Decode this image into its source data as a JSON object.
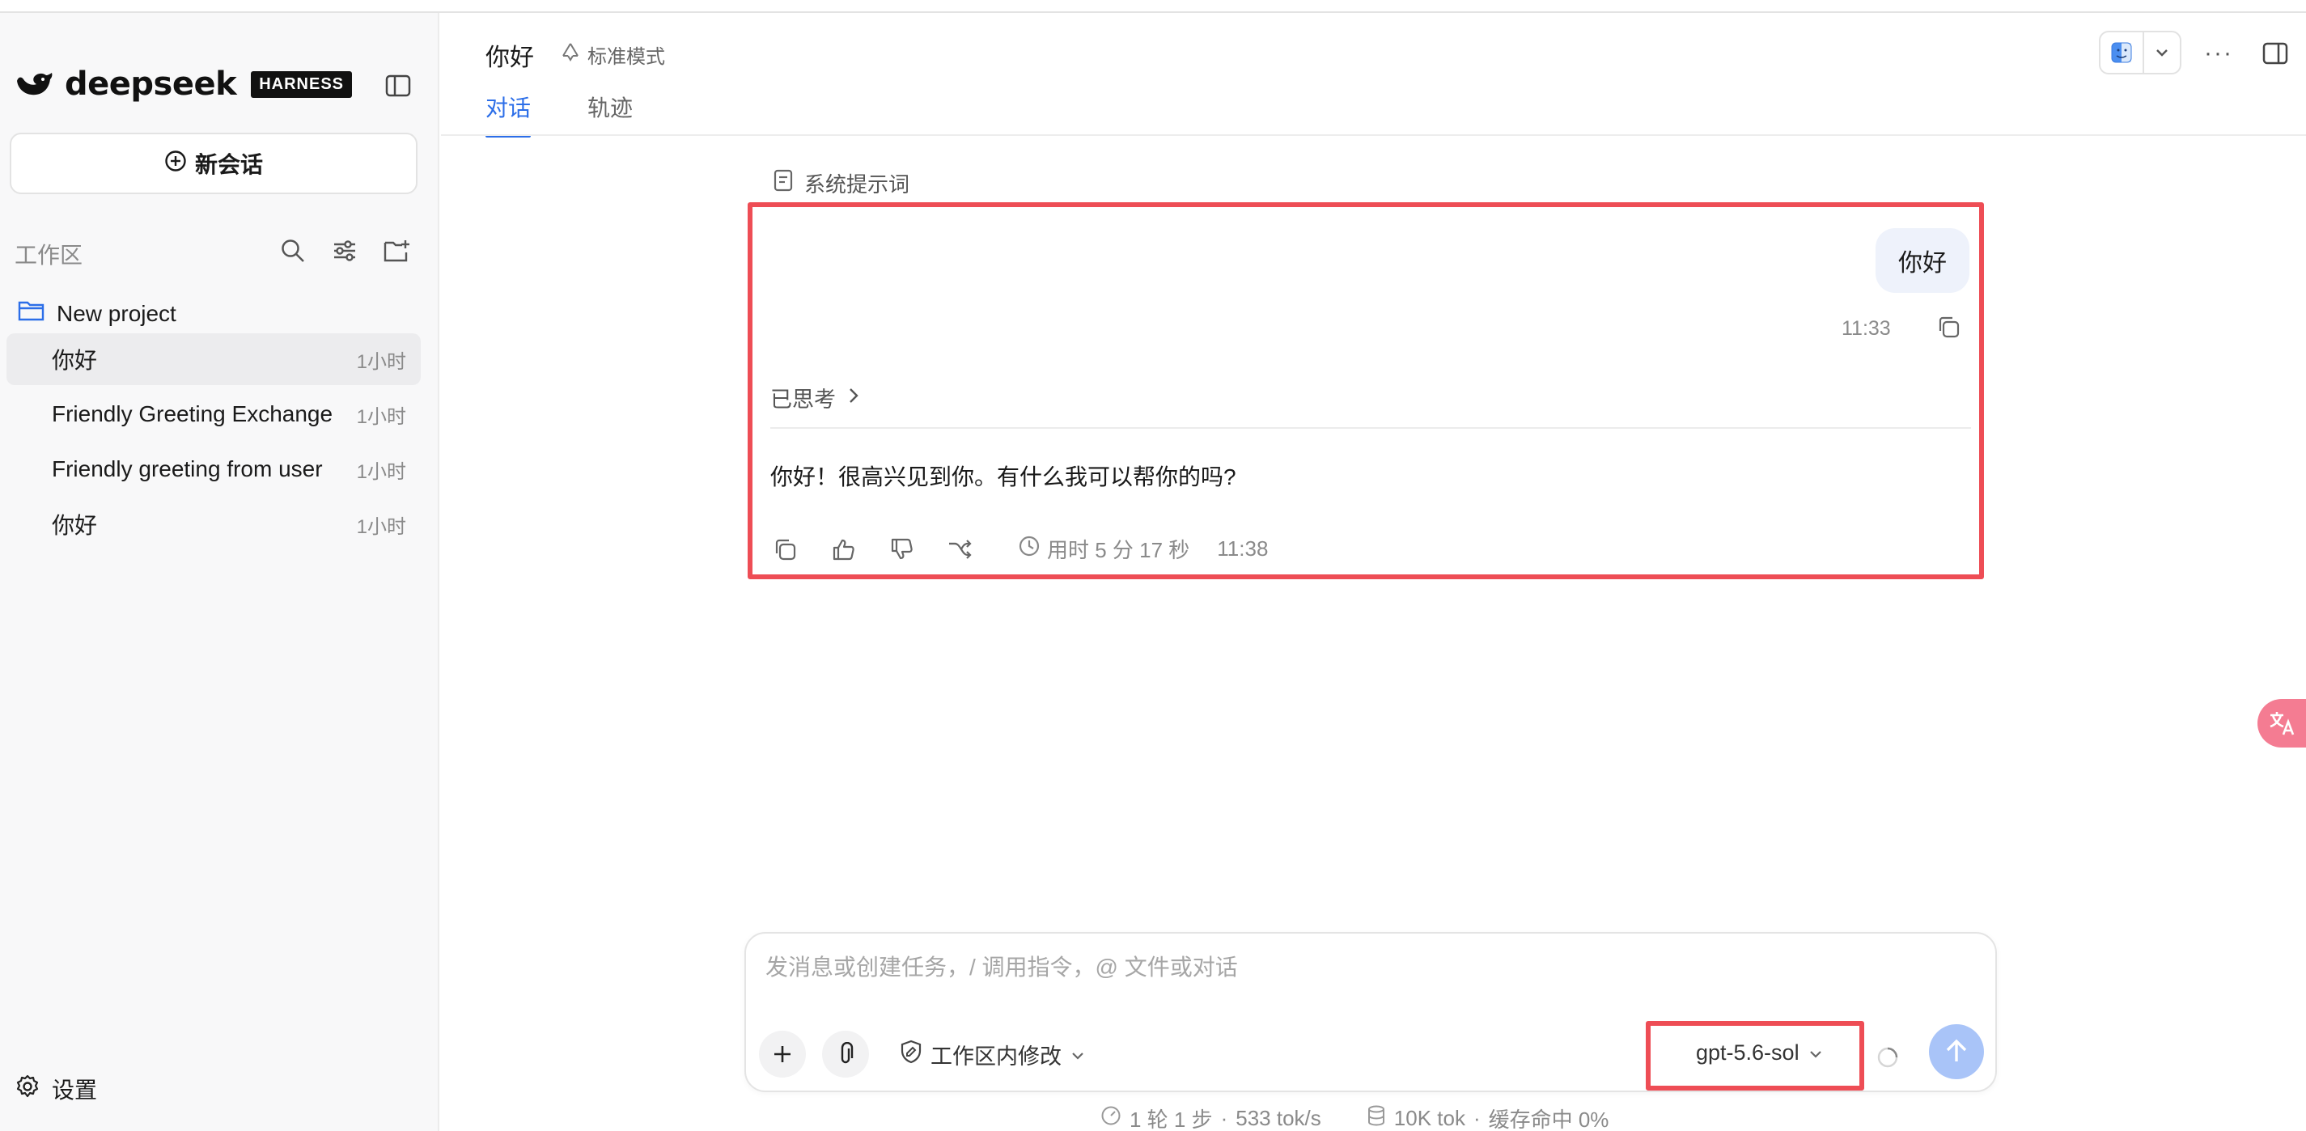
{
  "sidebar": {
    "brand_name": "deepseek",
    "brand_badge": "HARNESS",
    "new_chat_label": "新会话",
    "workspace_label": "工作区",
    "project_name": "New project",
    "conversations": [
      {
        "title": "你好",
        "age": "1小时"
      },
      {
        "title": "Friendly Greeting Exchange",
        "age": "1小时"
      },
      {
        "title": "Friendly greeting from user",
        "age": "1小时"
      },
      {
        "title": "你好",
        "age": "1小时"
      }
    ],
    "settings_label": "设置"
  },
  "header": {
    "title": "你好",
    "mode_label": "标准模式",
    "tabs": [
      {
        "label": "对话",
        "active": true
      },
      {
        "label": "轨迹",
        "active": false
      }
    ],
    "more_label": "···"
  },
  "chat": {
    "system_prompt_label": "系统提示词",
    "user_message": "你好",
    "user_time": "11:33",
    "thought_label": "已思考",
    "assistant_reply": "你好！很高兴见到你。有什么我可以帮你的吗?",
    "duration_label": "用时 5 分 17 秒",
    "assistant_time": "11:38"
  },
  "composer": {
    "placeholder": "发消息或创建任务，/ 调用指令，@ 文件或对话",
    "scope_label": "工作区内修改",
    "model_label": "gpt-5.6-sol"
  },
  "stats": {
    "rounds": "1 轮 1 步",
    "speed": "533 tok/s",
    "tokens": "10K tok",
    "cache": "缓存命中 0%",
    "separator": "·"
  },
  "colors": {
    "accent": "#2c6ee8",
    "highlight": "#ee4d55",
    "send_button": "#a9c4f8",
    "user_bubble": "#eef2fb"
  },
  "icons": [
    "whale-logo-icon",
    "sidebar-toggle-icon",
    "plus-circle-icon",
    "search-icon",
    "filter-icon",
    "new-folder-icon",
    "folder-icon",
    "gear-icon",
    "recycle-icon",
    "finder-icon",
    "chevron-down-icon",
    "panel-icon",
    "document-icon",
    "copy-icon",
    "chevron-right-icon",
    "thumbs-up-icon",
    "thumbs-down-icon",
    "branch-icon",
    "clock-icon",
    "plus-icon",
    "paperclip-icon",
    "shield-edit-icon",
    "loading-icon",
    "arrow-up-icon",
    "gauge-icon",
    "database-icon",
    "translate-icon"
  ]
}
